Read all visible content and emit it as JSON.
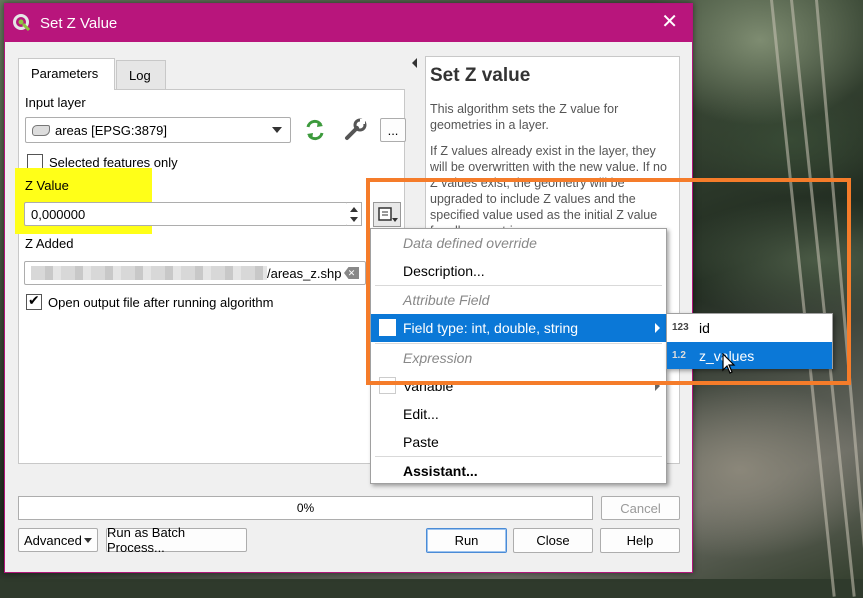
{
  "window": {
    "title": "Set Z Value"
  },
  "tabs": [
    {
      "label": "Parameters"
    },
    {
      "label": "Log"
    }
  ],
  "params": {
    "input_layer_label": "Input layer",
    "input_layer_value": "areas [EPSG:3879]",
    "selected_only_label": "Selected features only",
    "z_value_label": "Z Value",
    "z_value": "0,000000",
    "z_added_label": "Z Added",
    "z_added_value": "/areas_z.shp",
    "open_output_label": "Open output file after running algorithm",
    "more_button": "..."
  },
  "help": {
    "title": "Set Z value",
    "p1": "This algorithm sets the Z value for geometries in a layer.",
    "p2": "If Z values already exist in the layer, they will be overwritten with the new value. If no Z values exist, the geometry will be upgraded to include Z values and the specified value used as the initial Z value for all geometries."
  },
  "progress": {
    "text": "0%",
    "value": 0
  },
  "buttons": {
    "cancel": "Cancel",
    "advanced": "Advanced",
    "batch": "Run as Batch Process...",
    "run": "Run",
    "close": "Close",
    "help": "Help"
  },
  "menu": {
    "data_defined_override": "Data defined override",
    "description": "Description...",
    "attribute_field": "Attribute Field",
    "field_type": "Field type: int, double, string",
    "expression": "Expression",
    "variable": "Variable",
    "edit": "Edit...",
    "paste": "Paste",
    "assistant": "Assistant..."
  },
  "submenu": {
    "items": [
      {
        "icon": "123",
        "label": "id"
      },
      {
        "icon": "1.2",
        "label": "z_values"
      }
    ]
  },
  "colors": {
    "titlebar": "#b8157c",
    "highlight": "#0b78d7",
    "annotation_box": "#f57c2a",
    "annotation_highlight": "#ffff18"
  }
}
